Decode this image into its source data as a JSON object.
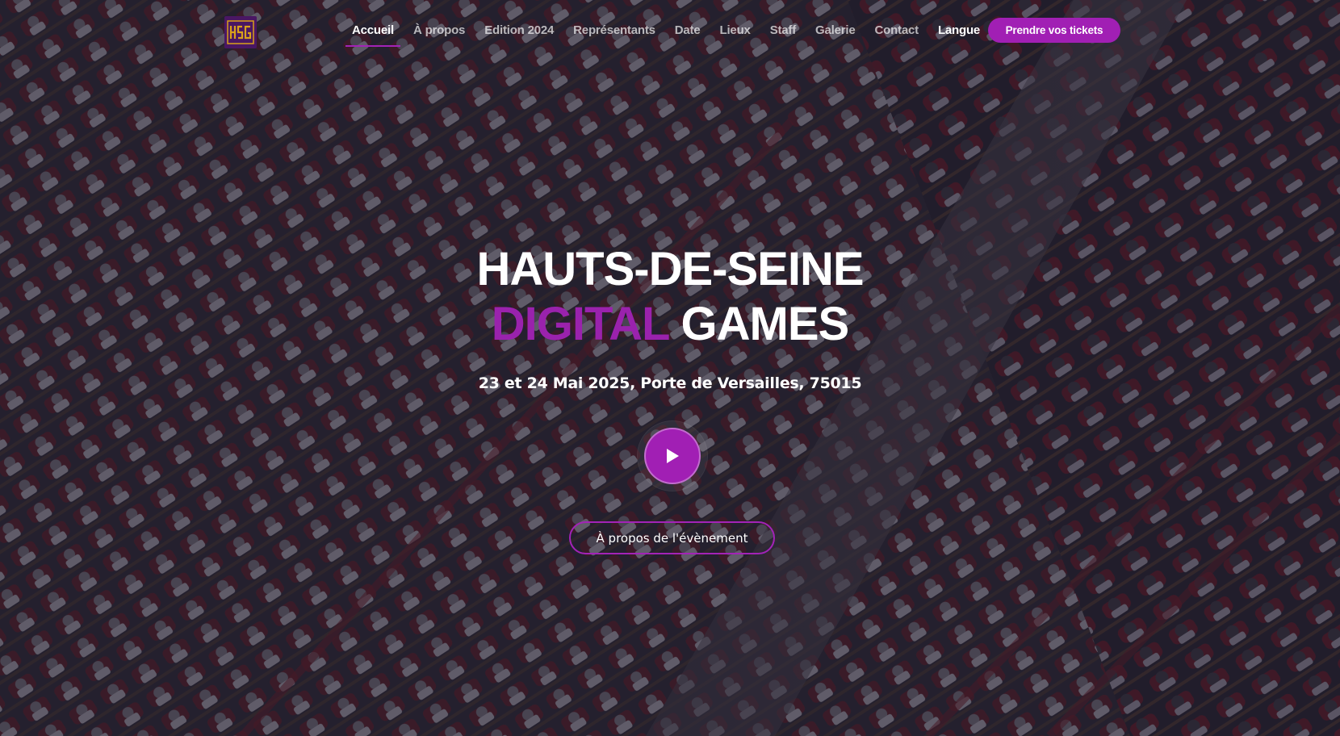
{
  "brand": {
    "logo_text": "HSDG",
    "accent_color": "#a11fb4"
  },
  "nav": {
    "items": [
      {
        "label": "Accueil",
        "active": true
      },
      {
        "label": "À propos"
      },
      {
        "label": "Edition 2024"
      },
      {
        "label": "Représentants"
      },
      {
        "label": "Date"
      },
      {
        "label": "Lieux"
      },
      {
        "label": "Staff"
      },
      {
        "label": "Galerie"
      },
      {
        "label": "Contact"
      },
      {
        "label": "Langue"
      }
    ],
    "cta_label": "Prendre vos tickets"
  },
  "hero": {
    "title_line1": "HAUTS-DE-SEINE",
    "title_accent": "DIGITAL",
    "title_rest": "GAMES",
    "subtitle": "23 et 24 Mai 2025, Porte de Versailles, 75015",
    "about_button": "À propos de l'évènement",
    "play_icon": "play-icon",
    "background": "auditorium-photo"
  }
}
